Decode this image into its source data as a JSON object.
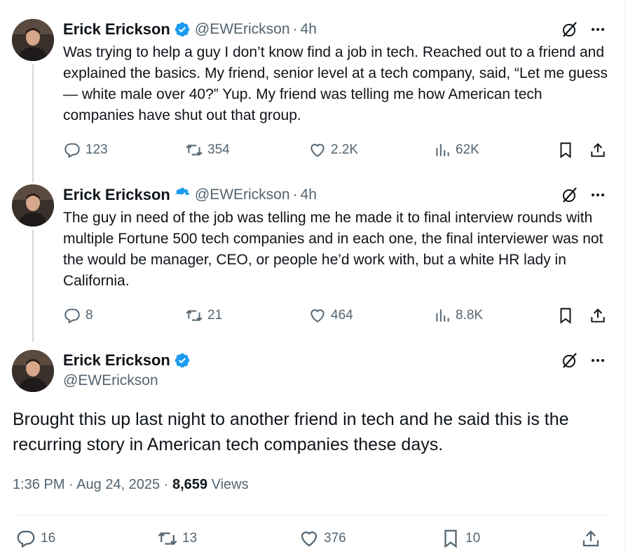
{
  "author": {
    "name": "Erick Erickson",
    "handle": "@EWErickson"
  },
  "tweets": [
    {
      "time": "4h",
      "text": "Was trying to help a guy I don’t know find a job in tech.  Reached out to a friend and explained the basics.  My friend, senior level at a tech company, said, “Let me guess — white male over 40?” Yup. My friend was telling me how American tech companies have shut out that group.",
      "replies": "123",
      "reposts": "354",
      "likes": "2.2K",
      "views": "62K"
    },
    {
      "time": "4h",
      "text": "The guy in need of the job was telling me he made it to final interview rounds with multiple Fortune 500 tech companies and in each one, the final interviewer was not the would be manager, CEO, or people he’d work with, but a white HR lady in California.",
      "replies": "8",
      "reposts": "21",
      "likes": "464",
      "views": "8.8K"
    }
  ],
  "main": {
    "text": "Brought this up last night to another friend in tech and he said this is the recurring story in American tech companies these days.",
    "time": "1:36 PM",
    "date": "Aug 24, 2025",
    "views_count": "8,659",
    "views_label": "Views",
    "replies": "16",
    "reposts": "13",
    "likes": "376",
    "bookmarks": "10"
  },
  "separator": "·",
  "icons": {
    "verified": "verified-badge-icon",
    "grok": "grok-icon",
    "more": "more-icon",
    "reply": "reply-icon",
    "repost": "repost-icon",
    "like": "heart-icon",
    "views": "views-icon",
    "bookmark": "bookmark-icon",
    "share": "share-icon"
  },
  "colors": {
    "text": "#0f1419",
    "secondary": "#536471",
    "verified": "#1d9bf0",
    "thread_line": "#cfd9de"
  }
}
